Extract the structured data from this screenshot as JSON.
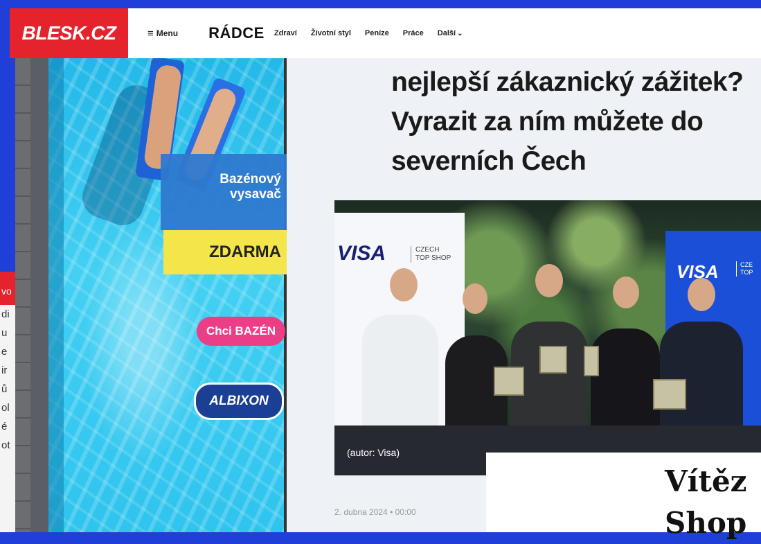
{
  "site": {
    "logo": "BLESK.CZ",
    "menu_label": "Menu",
    "section": "RÁDCE",
    "nav": [
      "Zdraví",
      "Životní styl",
      "Peníze",
      "Práce",
      "Další"
    ]
  },
  "ad": {
    "headline_line1": "Bazénový",
    "headline_line2": "vysavač",
    "free": "ZDARMA",
    "cta": "Chci BAZÉN",
    "brand": "ALBIXON"
  },
  "article": {
    "headline_line1": "nejlepší zákaznický zážitek?",
    "headline_line2": "Vyrazit za ním můžete do",
    "headline_line3": "severních Čech",
    "photo_caption": "(autor: Visa)",
    "date": "2. dubna 2024 • 00:00",
    "photo_banner_brand": "VISA",
    "photo_banner_sub1": "CZECH",
    "photo_banner_sub2": "TOP SHOP",
    "photo_banner_right_sub1": "CZE",
    "photo_banner_right_sub2": "TOP"
  },
  "overlay": {
    "line1": "Vítěz",
    "line2": "Shop"
  },
  "left_edge": {
    "top": "vo",
    "lines": [
      "di",
      "u",
      "e",
      "ir",
      "ů",
      "ol",
      "é",
      "ot"
    ]
  }
}
